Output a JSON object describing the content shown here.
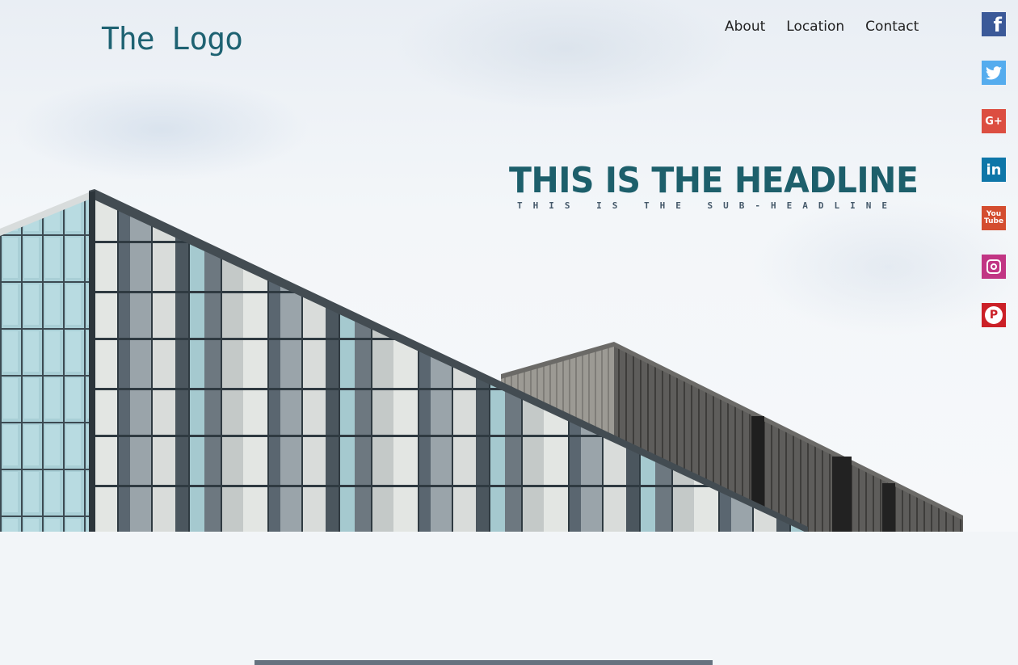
{
  "header": {
    "logo_text": "The Logo",
    "nav": [
      {
        "label": "About"
      },
      {
        "label": "Location"
      },
      {
        "label": "Contact"
      }
    ]
  },
  "hero": {
    "headline": "THIS IS THE HEADLINE",
    "subheadline": "THIS IS THE SUB-HEADLINE",
    "image_subject": "building-facade-photo"
  },
  "social": [
    {
      "name": "facebook-icon",
      "glyph": "f",
      "color": "#3b5998"
    },
    {
      "name": "twitter-icon",
      "glyph": "🐦",
      "color": "#55acee"
    },
    {
      "name": "google-plus-icon",
      "glyph": "G+",
      "color": "#dc4e41"
    },
    {
      "name": "linkedin-icon",
      "glyph": "in",
      "color": "#0e76a8"
    },
    {
      "name": "youtube-icon",
      "glyph_top": "You",
      "glyph_bottom": "Tube",
      "color": "#d44d2f"
    },
    {
      "name": "instagram-icon",
      "color": "#c13584"
    },
    {
      "name": "pinterest-icon",
      "glyph": "P",
      "color": "#cb2027"
    }
  ],
  "colors": {
    "brand": "#1d5f6b",
    "page_background": "#f2f5f8"
  }
}
